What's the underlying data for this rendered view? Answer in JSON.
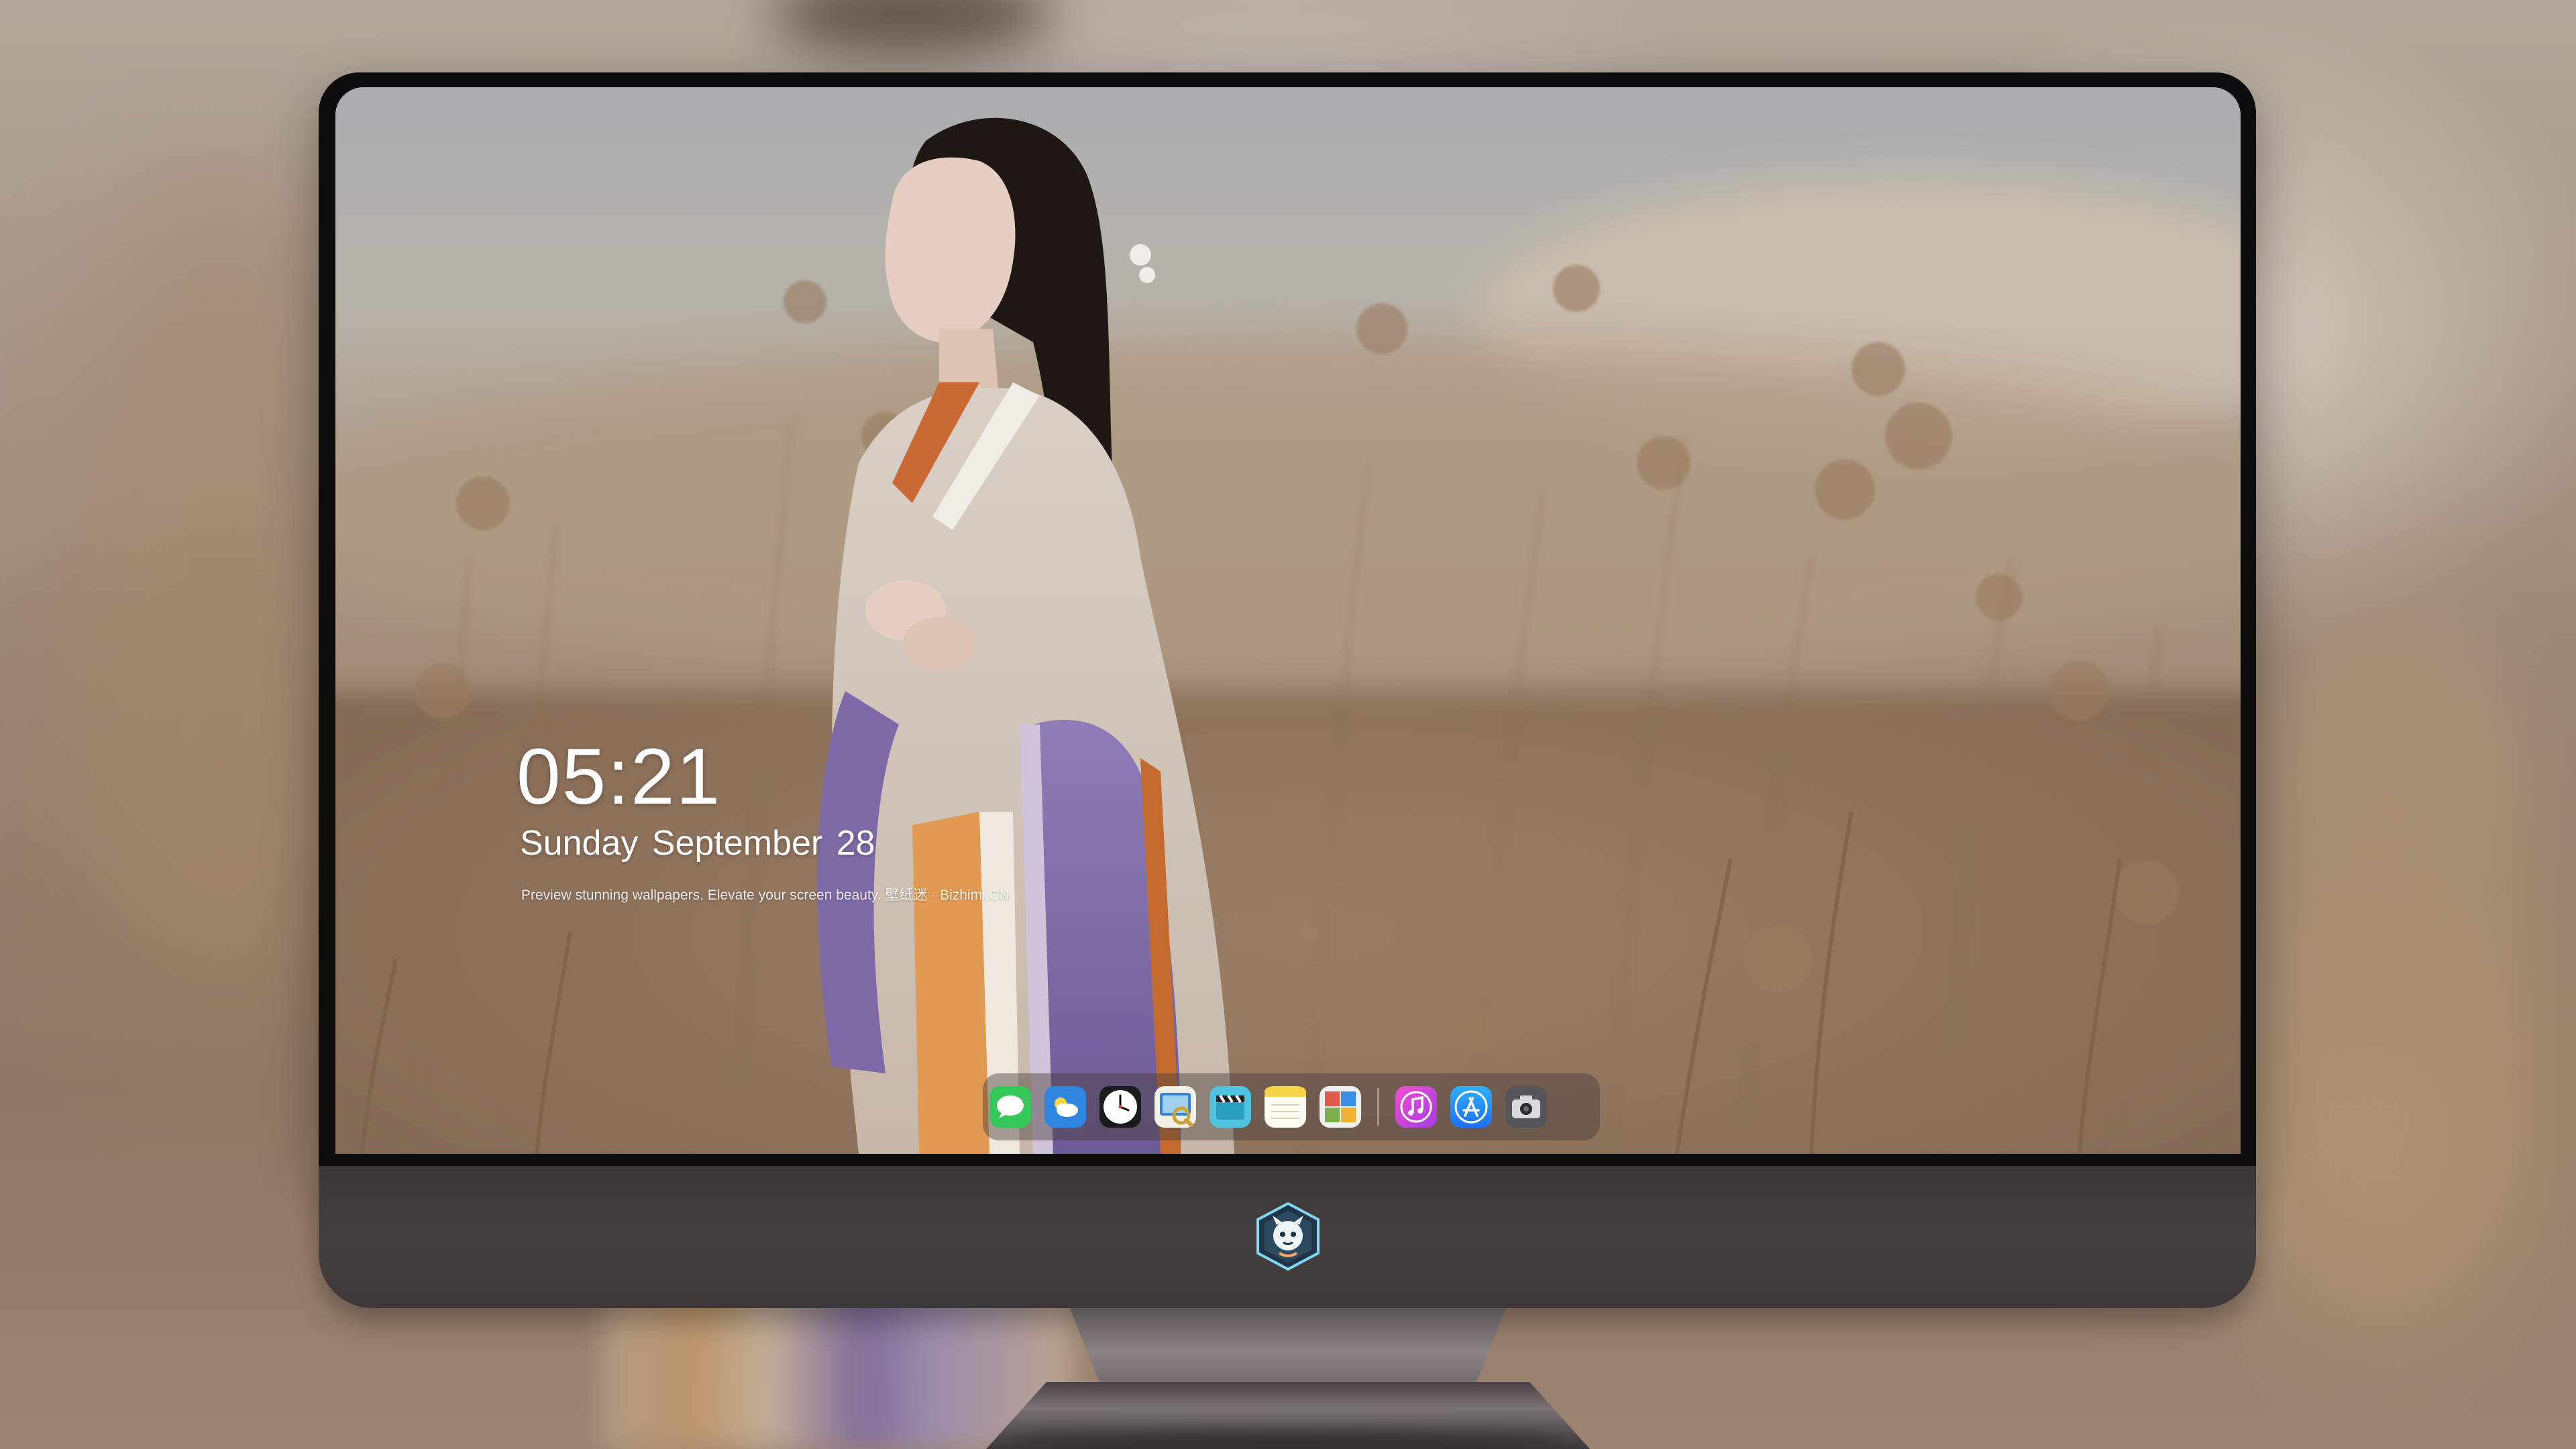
{
  "lock_screen": {
    "time": "05:21",
    "date": "Sunday September  28",
    "caption": "Preview stunning wallpapers. Elevate your screen beauty. 壁纸迷 · Bizhimi.CN"
  },
  "dock": {
    "apps": [
      {
        "name": "Messages",
        "icon": "messages-icon",
        "color": "#34c759"
      },
      {
        "name": "Weather",
        "icon": "weather-icon",
        "color": "#3a8ee6"
      },
      {
        "name": "Clock",
        "icon": "clock-icon",
        "color": "#1c1c1e"
      },
      {
        "name": "Preview",
        "icon": "preview-icon",
        "color": "#e8c84a"
      },
      {
        "name": "Clips",
        "icon": "clapperboard-icon",
        "color": "#4fc3e0"
      },
      {
        "name": "Notes",
        "icon": "notes-icon",
        "color": "#f5d547"
      },
      {
        "name": "Photo Booth",
        "icon": "photo-booth-icon",
        "color": "#7bb04c"
      },
      {
        "name": "Music",
        "icon": "music-icon",
        "color": "#d63fd6"
      },
      {
        "name": "App Store",
        "icon": "app-store-icon",
        "color": "#1e8ef5"
      },
      {
        "name": "Screenshot",
        "icon": "camera-icon",
        "color": "#5a5a5e"
      }
    ]
  },
  "monitor": {
    "logo": "dragon-mascot-logo",
    "frame_color": "#0d0d0e",
    "chin_color": "#423b3c"
  }
}
